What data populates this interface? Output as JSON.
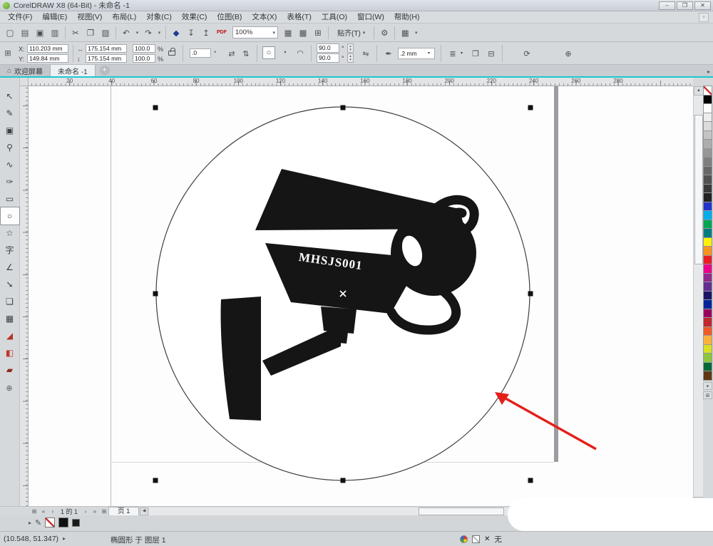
{
  "window": {
    "title": "CorelDRAW X8 (64-Bit) - 未命名 -1",
    "minimize": "–",
    "maximize": "❐",
    "close": "✕"
  },
  "glyphs": {
    "dropdown": "▾",
    "spin_up": "▴",
    "spin_down": "▾",
    "flyout": "▸",
    "up": "▲",
    "down": "▼",
    "left": "◀",
    "right": "▶",
    "home": "⌂",
    "percent": "%",
    "degree": "°",
    "small_box": "▫",
    "pen": "✎",
    "x_mark": "✕"
  },
  "menubar": {
    "items": [
      {
        "label": "文件(F)"
      },
      {
        "label": "编辑(E)"
      },
      {
        "label": "视图(V)"
      },
      {
        "label": "布局(L)"
      },
      {
        "label": "对象(C)"
      },
      {
        "label": "效果(C)"
      },
      {
        "label": "位图(B)"
      },
      {
        "label": "文本(X)"
      },
      {
        "label": "表格(T)"
      },
      {
        "label": "工具(O)"
      },
      {
        "label": "窗口(W)"
      },
      {
        "label": "帮助(H)"
      }
    ]
  },
  "toolbar": {
    "icons_a": [
      {
        "g": "▢",
        "n": "new-document-icon"
      },
      {
        "g": "▤",
        "n": "open-icon"
      },
      {
        "g": "▣",
        "n": "save-icon"
      },
      {
        "g": "▥",
        "n": "print-icon"
      },
      {
        "cls": "sep",
        "n": "toolbar-separator"
      },
      {
        "g": "✂",
        "n": "cut-icon"
      },
      {
        "g": "❐",
        "n": "copy-icon"
      },
      {
        "g": "▨",
        "n": "paste-icon"
      },
      {
        "cls": "sep",
        "n": "toolbar-separator"
      },
      {
        "g": "↶",
        "n": "undo-icon"
      },
      {
        "g": "▾",
        "n": "undo-dropdown-icon",
        "cls": "dd"
      },
      {
        "g": "↷",
        "n": "redo-icon"
      },
      {
        "g": "▾",
        "n": "redo-dropdown-icon",
        "cls": "dd"
      },
      {
        "cls": "sep",
        "n": "toolbar-separator"
      },
      {
        "g": "◆",
        "n": "search-content-icon",
        "c": "#1d3e8f"
      },
      {
        "g": "↧",
        "n": "import-icon"
      },
      {
        "g": "↥",
        "n": "export-icon"
      },
      {
        "g": "PDF",
        "n": "publish-pdf-icon",
        "c": "#bb1111",
        "cls": "pdf"
      }
    ],
    "zoom_value": "100%",
    "icons_b": [
      {
        "g": "▦",
        "n": "full-screen-preview-icon"
      },
      {
        "g": "▩",
        "n": "view-rulers-icon"
      },
      {
        "g": "⊞",
        "n": "view-grid-icon"
      },
      {
        "cls": "sep",
        "n": "toolbar-separator"
      }
    ],
    "snap_label": "贴齐(T)",
    "icons_c": [
      {
        "cls": "sep",
        "n": "toolbar-separator"
      },
      {
        "g": "⚙",
        "n": "options-icon"
      },
      {
        "cls": "sep",
        "n": "toolbar-separator"
      },
      {
        "g": "▦",
        "n": "launcher-icon"
      },
      {
        "g": "▾",
        "n": "launcher-dropdown-icon",
        "cls": "dd"
      }
    ]
  },
  "propbar": {
    "pos_glyph": "⊞",
    "x_label": "X:",
    "x_value": "110.203 mm",
    "y_label": "Y:",
    "y_value": "149.84 mm",
    "w_icon": "↔",
    "h_icon": "↕",
    "w_value": "175.154 mm",
    "h_value": "175.154 mm",
    "scale_x": "100.0",
    "scale_y": "100.0",
    "angle_value": ".0",
    "mirror_h": "⇄",
    "mirror_v": "⇅",
    "ellipse_glyph": "○",
    "pie_glyph": "◔",
    "arc_glyph": "◠",
    "arc_start": "90.0",
    "arc_end": "90.0",
    "direction_glyph": "⇋",
    "outline_pen": "✒",
    "outline_value": ".2 mm",
    "wrap_glyph": "≣",
    "convert_glyph": "❒",
    "flatten_glyph": "⊟",
    "refresh_glyph": "⟳",
    "plus_glyph": "⊕"
  },
  "tabs": {
    "welcome": "欢迎屏幕",
    "document": "未命名 -1",
    "add": "+"
  },
  "hruler": {
    "numbers": [
      "20",
      "40",
      "60",
      "80",
      "100",
      "120",
      "140",
      "160",
      "180",
      "200",
      "220",
      "240",
      "260",
      "280"
    ]
  },
  "toolbox": {
    "tools": [
      {
        "g": "↖",
        "n": "pick-tool"
      },
      {
        "g": "✎",
        "n": "shape-tool"
      },
      {
        "g": "▣",
        "n": "crop-tool"
      },
      {
        "g": "⚲",
        "n": "zoom-tool"
      },
      {
        "g": "∿",
        "n": "freehand-tool"
      },
      {
        "g": "✑",
        "n": "artistic-media-tool"
      },
      {
        "g": "▭",
        "n": "rectangle-tool"
      },
      {
        "g": "○",
        "n": "ellipse-tool",
        "cls": "active"
      },
      {
        "g": "☆",
        "n": "polygon-tool"
      },
      {
        "g": "字",
        "n": "text-tool"
      },
      {
        "g": "∠",
        "n": "dimension-tool"
      },
      {
        "g": "➘",
        "n": "connector-tool"
      },
      {
        "g": "❏",
        "n": "drop-shadow-tool"
      },
      {
        "g": "▦",
        "n": "transparency-tool"
      },
      {
        "g": "◢",
        "n": "color-eyedropper-tool",
        "c": "#b5342a"
      },
      {
        "g": "◧",
        "n": "interactive-fill-tool",
        "c": "#c0392b"
      },
      {
        "g": "▰",
        "n": "smart-fill-tool",
        "c": "#8e2a20"
      }
    ],
    "add_glyph": "⊕"
  },
  "palette": {
    "colors": [
      {
        "c": "#000000"
      },
      {
        "c": "#ffffff"
      },
      {
        "c": "#ededed"
      },
      {
        "c": "#dbdbdb"
      },
      {
        "c": "#c4c4c4"
      },
      {
        "c": "#adadad"
      },
      {
        "c": "#969696"
      },
      {
        "c": "#7f7f7f"
      },
      {
        "c": "#686868"
      },
      {
        "c": "#515151"
      },
      {
        "c": "#3a3a3a"
      },
      {
        "c": "#232323"
      },
      {
        "c": "#2335cc"
      },
      {
        "c": "#00adef"
      },
      {
        "c": "#00a651"
      },
      {
        "c": "#007c80"
      },
      {
        "c": "#fff200"
      },
      {
        "c": "#f7941d"
      },
      {
        "c": "#ed1c24"
      },
      {
        "c": "#ec008c"
      },
      {
        "c": "#92278f"
      },
      {
        "c": "#662d91"
      },
      {
        "c": "#1b1464"
      },
      {
        "c": "#00239c"
      },
      {
        "c": "#9e005d"
      },
      {
        "c": "#c1272d"
      },
      {
        "c": "#f15a24"
      },
      {
        "c": "#fbb03b"
      },
      {
        "c": "#d9e021"
      },
      {
        "c": "#8cc63f"
      },
      {
        "c": "#006837"
      },
      {
        "c": "#603813"
      }
    ],
    "down_glyph": "▾",
    "flyout_glyph": "⊞"
  },
  "canvas": {
    "camera_label": "MHSJS001"
  },
  "pagebar": {
    "add_left": "⊞",
    "first": "«",
    "prev": "‹",
    "info": "1 的 1",
    "next": "›",
    "last": "»",
    "add_right": "⊞",
    "tab": "页 1"
  },
  "statusbar": {
    "coords": "(10.548, 51.347)",
    "object_info": "椭圆形 于 图层 1",
    "none_label": "无"
  }
}
